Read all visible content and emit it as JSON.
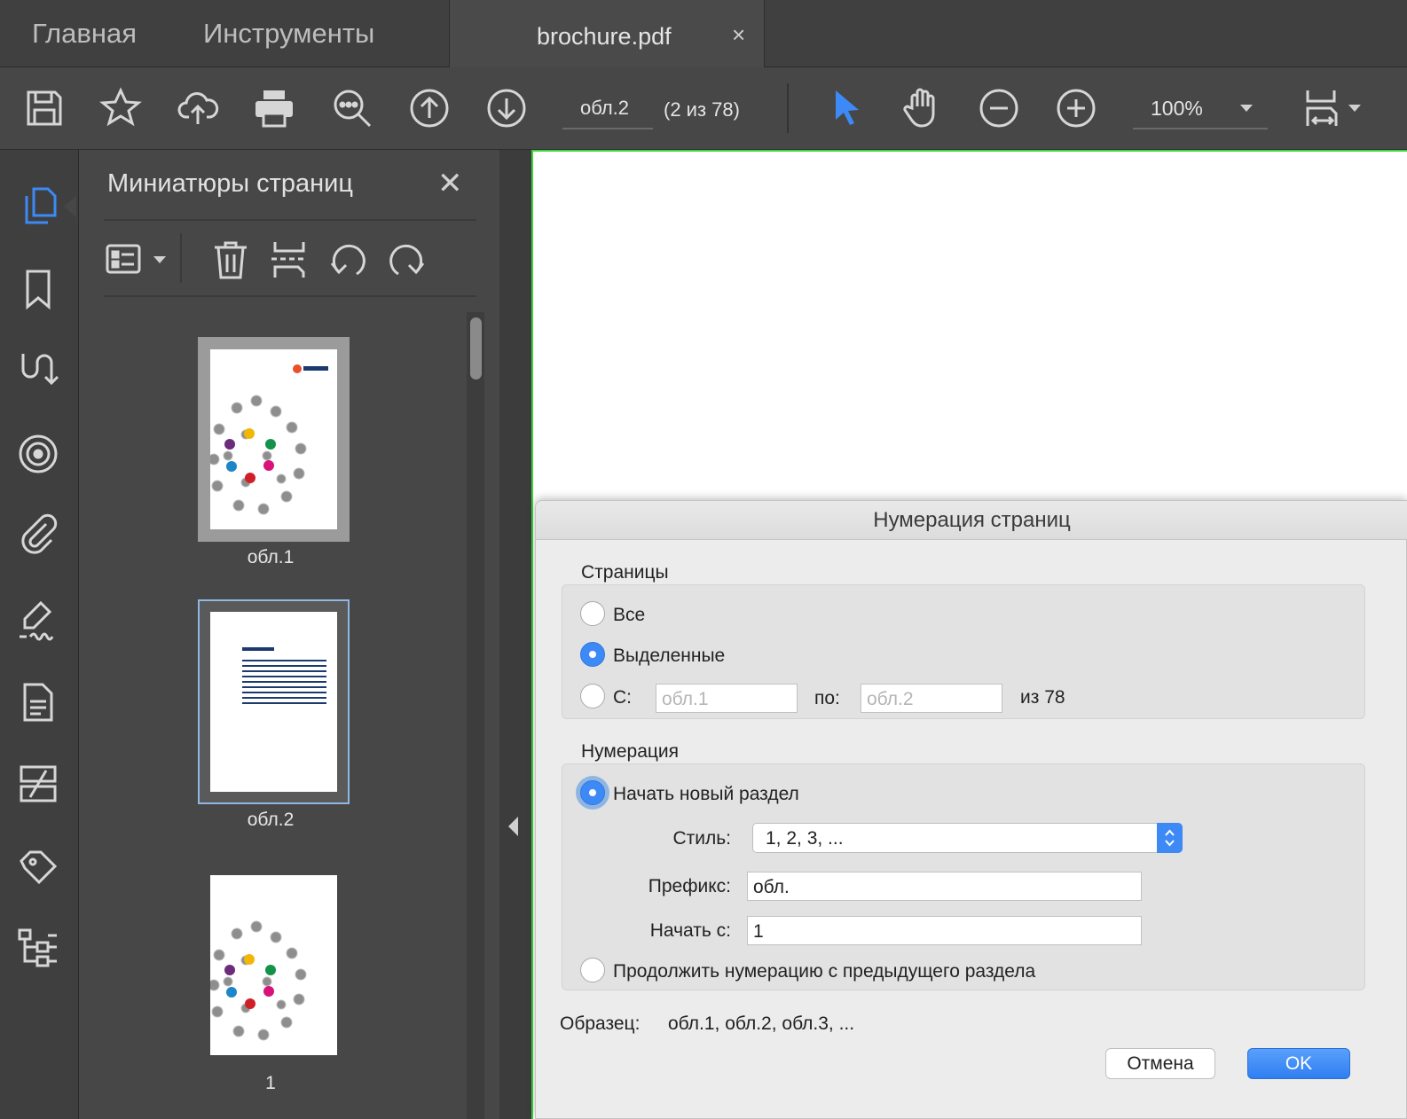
{
  "tabs": {
    "home": "Главная",
    "tools": "Инструменты",
    "document": "brochure.pdf",
    "close": "×"
  },
  "toolbar": {
    "page_field": "обл.2",
    "page_count": "(2 из 78)",
    "zoom": "100%"
  },
  "thumbnails_panel": {
    "title": "Миниатюры страниц",
    "close": "✕",
    "pages": [
      {
        "label": "обл.1",
        "selected": false
      },
      {
        "label": "обл.2",
        "selected": true
      },
      {
        "label": "1",
        "selected": false
      }
    ]
  },
  "dialog": {
    "title": "Нумерация страниц",
    "pages_group": {
      "label": "Страницы",
      "option_all": "Все",
      "option_selected": "Выделенные",
      "option_range": "С:",
      "from_placeholder": "обл.1",
      "to_label": "по:",
      "to_placeholder": "обл.2",
      "total": "из 78",
      "selected_option": "selected"
    },
    "numbering_group": {
      "label": "Нумерация",
      "option_new_section": "Начать новый раздел",
      "style_label": "Стиль:",
      "style_value": "1, 2, 3, ...",
      "prefix_label": "Префикс:",
      "prefix_value": "обл.",
      "start_label": "Начать с:",
      "start_value": "1",
      "option_continue": "Продолжить нумерацию с предыдущего раздела",
      "selected_option": "new_section"
    },
    "sample_label": "Образец:",
    "sample_value": "обл.1, обл.2, обл.3, ...",
    "cancel_button": "Отмена",
    "ok_button": "OK"
  },
  "colors": {
    "accent": "#3d8af7",
    "doc_border": "#3bd43b"
  }
}
